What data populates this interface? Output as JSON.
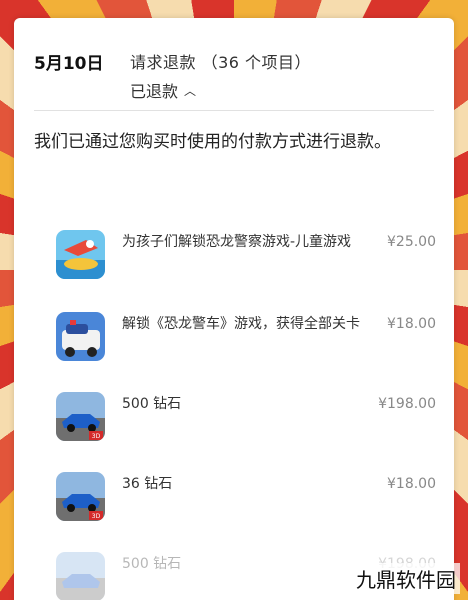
{
  "header": {
    "date": "5月10日",
    "request": "请求退款 （36 个项目）",
    "status": "已退款"
  },
  "notice": "我们已通过您购买时使用的付款方式进行退款。",
  "items": [
    {
      "name": "为孩子们解锁恐龙警察游戏-儿童游戏",
      "price": "¥25.00",
      "icon": "kids-game-icon"
    },
    {
      "name": "解锁《恐龙警车》游戏，获得全部关卡",
      "price": "¥18.00",
      "icon": "police-car-icon"
    },
    {
      "name": "500 钻石",
      "price": "¥198.00",
      "icon": "racing-car-3d-icon"
    },
    {
      "name": "36 钻石",
      "price": "¥18.00",
      "icon": "racing-car-3d-icon"
    },
    {
      "name": "500 钻石",
      "price": "¥198.00",
      "icon": "racing-car-icon"
    }
  ],
  "watermark": "九鼎软件园"
}
